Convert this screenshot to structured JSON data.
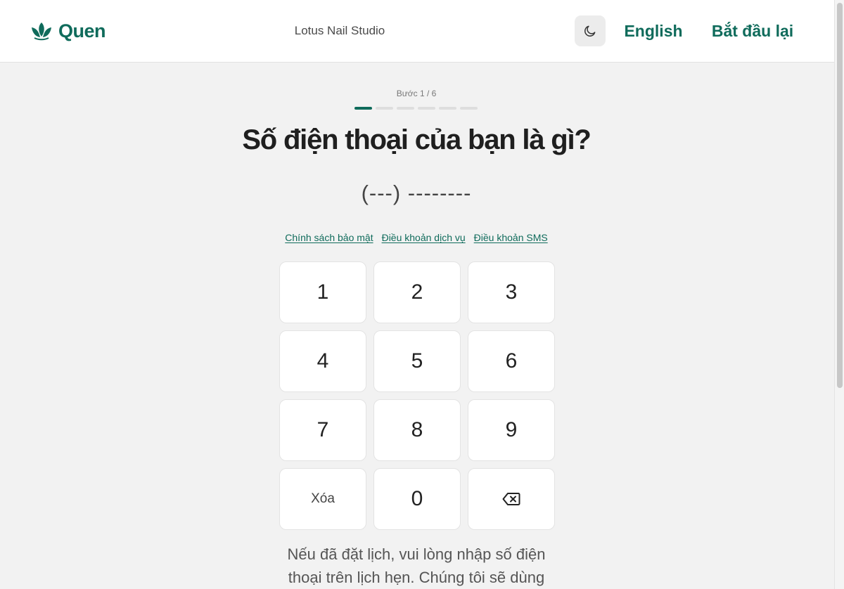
{
  "header": {
    "brand_name": "Quen",
    "brand_icon": "lotus-icon",
    "studio_name": "Lotus Nail Studio",
    "theme_icon": "moon-icon",
    "language_label": "English",
    "restart_label": "Bắt đầu lại"
  },
  "step": {
    "label": "Bước 1 / 6",
    "current": 1,
    "total": 6
  },
  "question": "Số điện thoại của bạn là gì?",
  "phone_display": "(---) --------",
  "links": [
    {
      "label": "Chính sách bảo mật"
    },
    {
      "label": "Điều khoản dịch vụ"
    },
    {
      "label": "Điều khoản SMS"
    }
  ],
  "keypad": {
    "keys": [
      "1",
      "2",
      "3",
      "4",
      "5",
      "6",
      "7",
      "8",
      "9"
    ],
    "clear_label": "Xóa",
    "zero": "0",
    "backspace_icon": "backspace-icon"
  },
  "help_text": "Nếu đã đặt lịch, vui lòng nhập số điện thoại trên lịch hẹn. Chúng tôi sẽ dùng",
  "colors": {
    "brand": "#0f6b5b",
    "background": "#f2f2f2",
    "surface": "#ffffff"
  }
}
